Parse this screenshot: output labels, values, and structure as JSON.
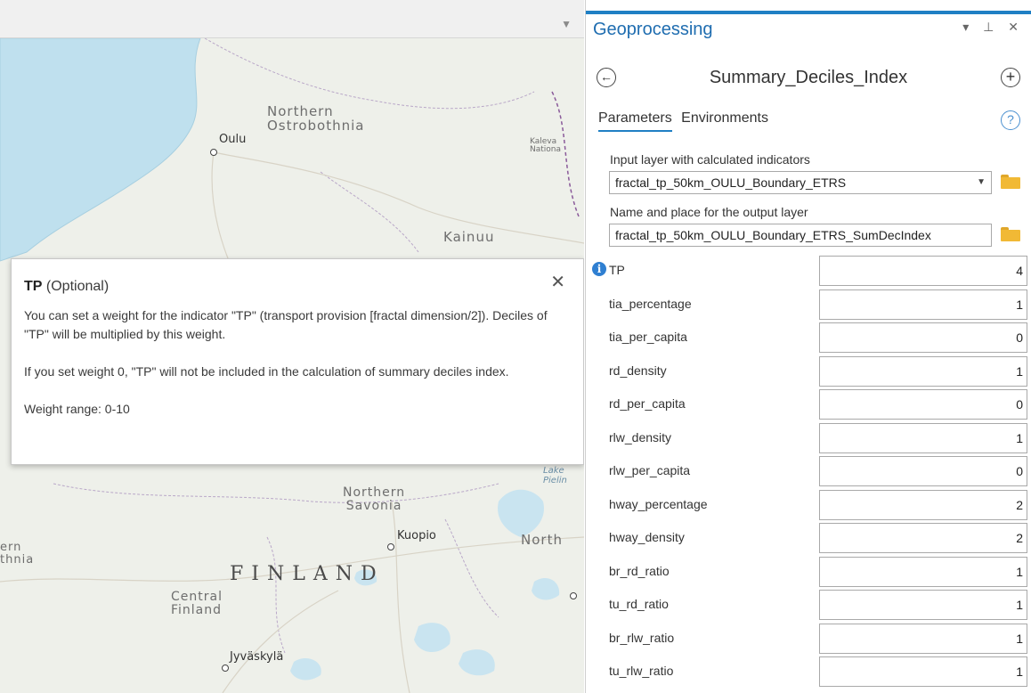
{
  "map": {
    "labels": {
      "northern_ostrobothnia": "Northern\nOstrobothnia",
      "kainuu": "Kainuu",
      "northern_savonia": "Northern\nSavonia",
      "finland": "FINLAND",
      "central_finland": "Central\nFinland",
      "north": "North",
      "ern": "ern\nthnia",
      "kaleva": "Kaleva\nNationa",
      "lake": "Lake\nPielin"
    },
    "cities": {
      "oulu": "Oulu",
      "kuopio": "Kuopio",
      "jyvaskyla": "Jyväskylä"
    }
  },
  "popup": {
    "param_name": "TP",
    "param_suffix": " (Optional)",
    "paragraph1": "You can set a weight for the indicator \"TP\" (transport provision [fractal dimension/2]). Deciles of \"TP\" will be multiplied by this weight.",
    "paragraph2": "If you set weight 0, \"TP\" will not be included in the calculation of summary deciles index.",
    "paragraph3": "Weight range: 0-10",
    "close_glyph": "✕"
  },
  "gp": {
    "pane_title": "Geoprocessing",
    "pane_controls": "▾ ⊥ ✕",
    "tool_name": "Summary_Deciles_Index",
    "tabs": [
      "Parameters",
      "Environments"
    ],
    "input_label": "Input layer with calculated indicators",
    "input_value": "fractal_tp_50km_OULU_Boundary_ETRS",
    "output_label": "Name and place for the output layer",
    "output_value": "fractal_tp_50km_OULU_Boundary_ETRS_SumDecIndex",
    "params": [
      {
        "name": "TP",
        "value": "4"
      },
      {
        "name": "tia_percentage",
        "value": "1"
      },
      {
        "name": "tia_per_capita",
        "value": "0"
      },
      {
        "name": "rd_density",
        "value": "1"
      },
      {
        "name": "rd_per_capita",
        "value": "0"
      },
      {
        "name": "rlw_density",
        "value": "1"
      },
      {
        "name": "rlw_per_capita",
        "value": "0"
      },
      {
        "name": "hway_percentage",
        "value": "2"
      },
      {
        "name": "hway_density",
        "value": "2"
      },
      {
        "name": "br_rd_ratio",
        "value": "1"
      },
      {
        "name": "tu_rd_ratio",
        "value": "1"
      },
      {
        "name": "br_rlw_ratio",
        "value": "1"
      },
      {
        "name": "tu_rlw_ratio",
        "value": "1"
      }
    ]
  },
  "colors": {
    "accent": "#1f7fc4",
    "sea": "#bfe0ee",
    "land": "#eef0ea",
    "info_icon": "#2f7fd1",
    "folder": "#f1b935"
  }
}
